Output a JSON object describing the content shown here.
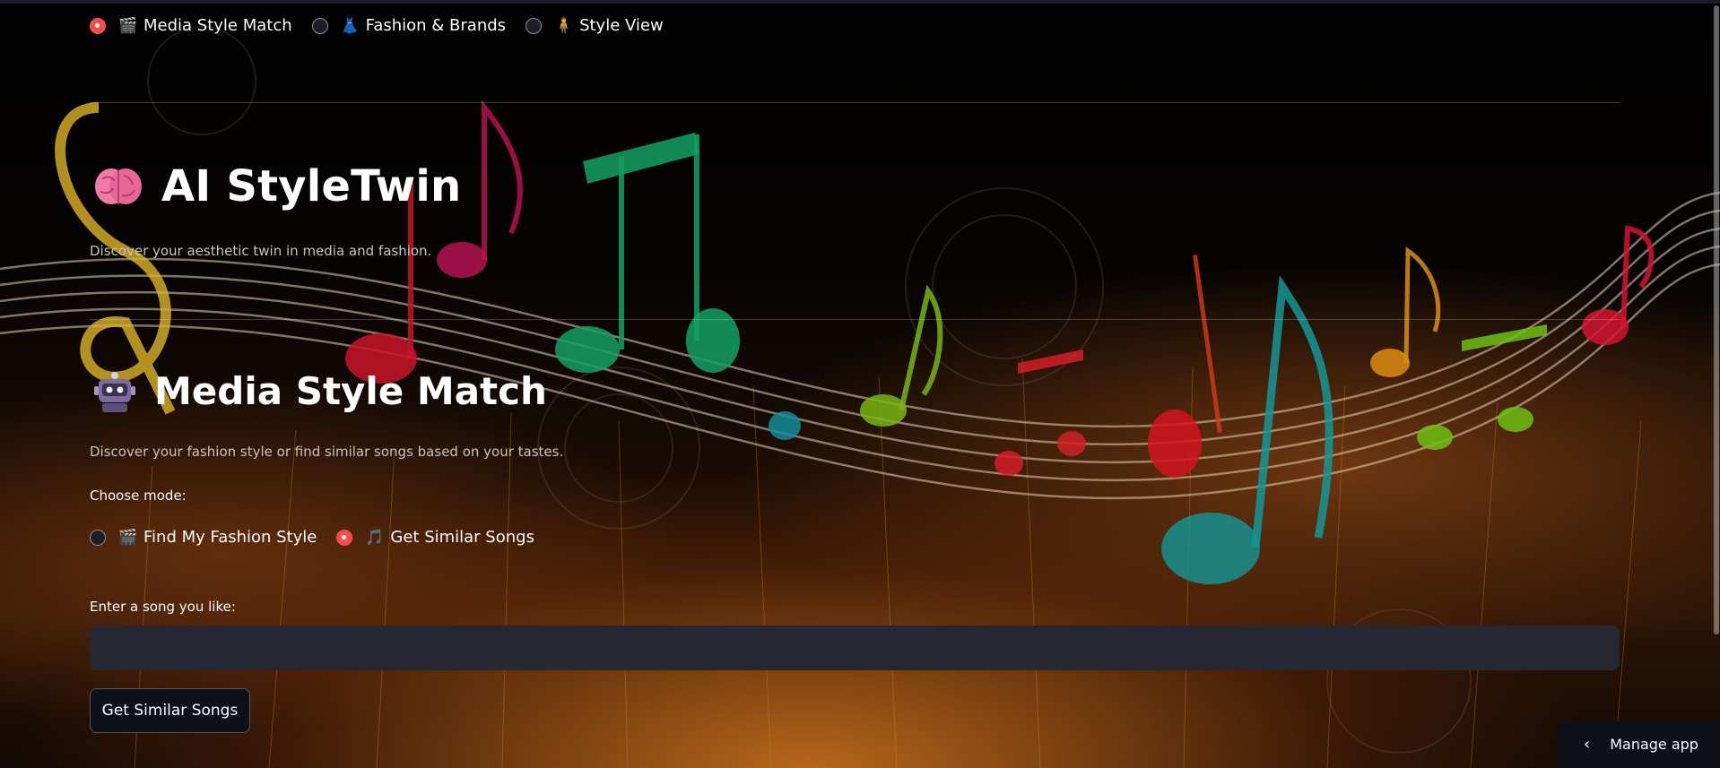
{
  "nav": {
    "options": [
      {
        "icon": "clapperboard-icon",
        "glyph": "🎬",
        "label": "Media Style Match",
        "selected": true
      },
      {
        "icon": "dress-icon",
        "glyph": "👗",
        "label": "Fashion & Brands",
        "selected": false
      },
      {
        "icon": "person-icon",
        "glyph": "🧍",
        "label": "Style View",
        "selected": false
      }
    ]
  },
  "header": {
    "title": "AI StyleTwin",
    "icon": "brain-icon",
    "subtitle": "Discover your aesthetic twin in media and fashion."
  },
  "section": {
    "title": "Media Style Match",
    "icon": "robot-icon",
    "description": "Discover your fashion style or find similar songs based on your tastes.",
    "mode_label": "Choose mode:",
    "modes": [
      {
        "icon": "clapperboard-icon",
        "glyph": "🎬",
        "label": "Find My Fashion Style",
        "selected": false
      },
      {
        "icon": "music-note-icon",
        "glyph": "🎵",
        "label": "Get Similar Songs",
        "selected": true
      }
    ],
    "song_input_label": "Enter a song you like:",
    "song_input_value": "",
    "submit_label": "Get Similar Songs"
  },
  "footer": {
    "manage_label": "Manage app"
  },
  "colors": {
    "accent": "#ff4b4b",
    "input_bg": "#262730",
    "button_bg": "#0e1117"
  }
}
